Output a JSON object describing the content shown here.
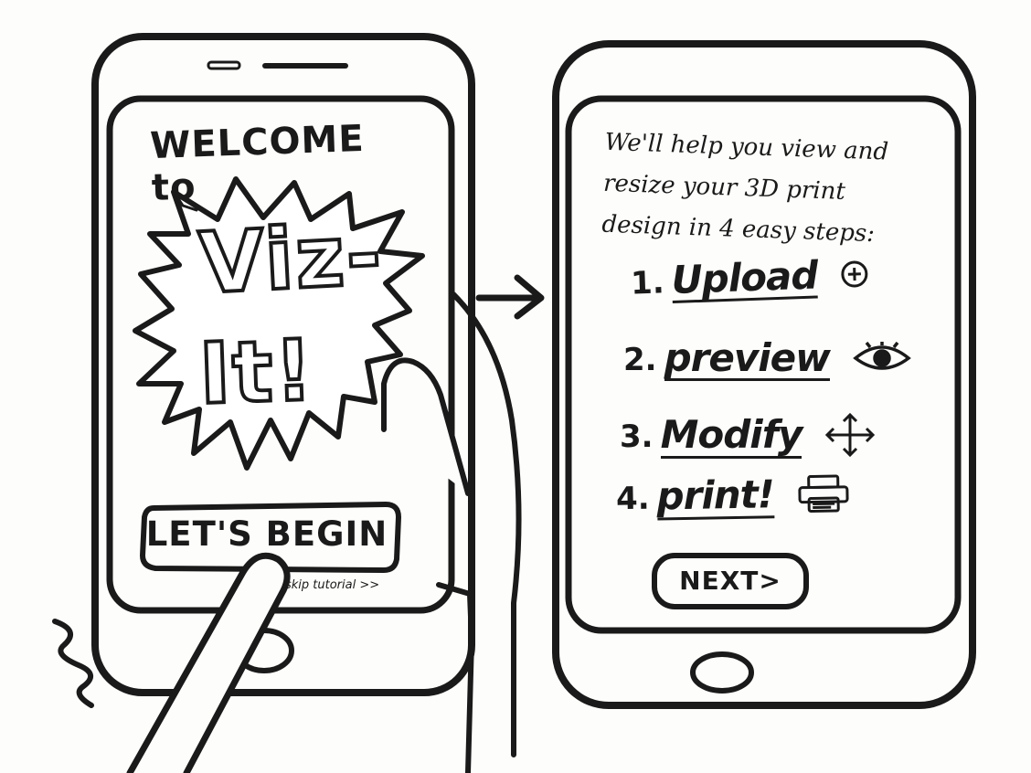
{
  "welcome_screen": {
    "heading": "WELCOME to",
    "logo_line1": "Viz-",
    "logo_line2": "It!",
    "begin_button": "LET'S BEGIN",
    "skip_link": "skip tutorial >>"
  },
  "steps_screen": {
    "intro": "We'll help you view and resize your 3D print design in 4 easy steps:",
    "steps": [
      {
        "number": "1.",
        "label": "Upload",
        "icon": "plus-circle-icon"
      },
      {
        "number": "2.",
        "label": "preview",
        "icon": "eye-icon"
      },
      {
        "number": "3.",
        "label": "Modify",
        "icon": "move-arrows-icon"
      },
      {
        "number": "4.",
        "label": "print!",
        "icon": "printer-icon"
      }
    ],
    "next_button": "NEXT>"
  },
  "transition_arrow_icon": "arrow-right-icon"
}
